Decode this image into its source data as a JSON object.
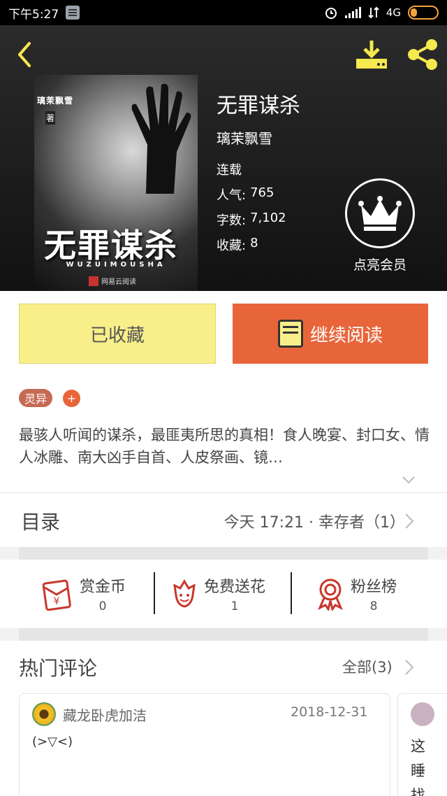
{
  "status_bar": {
    "time": "下午5:27",
    "network": "4G"
  },
  "book": {
    "title": "无罪谋杀",
    "author": "璃茉飘雪",
    "status": "连载",
    "popularity_label": "人气:",
    "popularity_value": "765",
    "words_label": "字数:",
    "words_value": "7,102",
    "favorites_label": "收藏:",
    "favorites_value": "8",
    "vip_label": "点亮会员"
  },
  "cover": {
    "author_text": "璃茉飘雪",
    "zhu": "著",
    "title_text": "无罪谋杀",
    "pinyin": "WUZUIMOUSHA",
    "publisher": "网易云阅读"
  },
  "buttons": {
    "favorited_label": "已收藏",
    "continue_label": "继续阅读"
  },
  "tags": {
    "items": [
      "灵异"
    ],
    "add_label": "+"
  },
  "description": "最骇人听闻的谋杀，最匪夷所思的真相！食人晚宴、封口女、情人冰雕、南大凶手自首、人皮祭画、镜…",
  "toc": {
    "label": "目录",
    "latest": "今天 17:21 · 幸存者（1）"
  },
  "actions": [
    {
      "label": "赏金币",
      "count": "0",
      "icon": "red-envelope-icon"
    },
    {
      "label": "免费送花",
      "count": "1",
      "icon": "flower-icon"
    },
    {
      "label": "粉丝榜",
      "count": "8",
      "icon": "medal-icon"
    }
  ],
  "hot_comments": {
    "title": "热门评论",
    "all_label": "全部(3)",
    "comments": [
      {
        "user": "藏龙卧虎加洁",
        "date": "2018-12-31",
        "text": "(>▽<)"
      },
      {
        "user": "",
        "date": "",
        "text": "这睡找"
      }
    ]
  },
  "colors": {
    "accent_yellow": "#f8ef8a",
    "accent_orange": "#e8653a",
    "icon_yellow": "#f6e84f",
    "icon_red": "#c9372c"
  }
}
